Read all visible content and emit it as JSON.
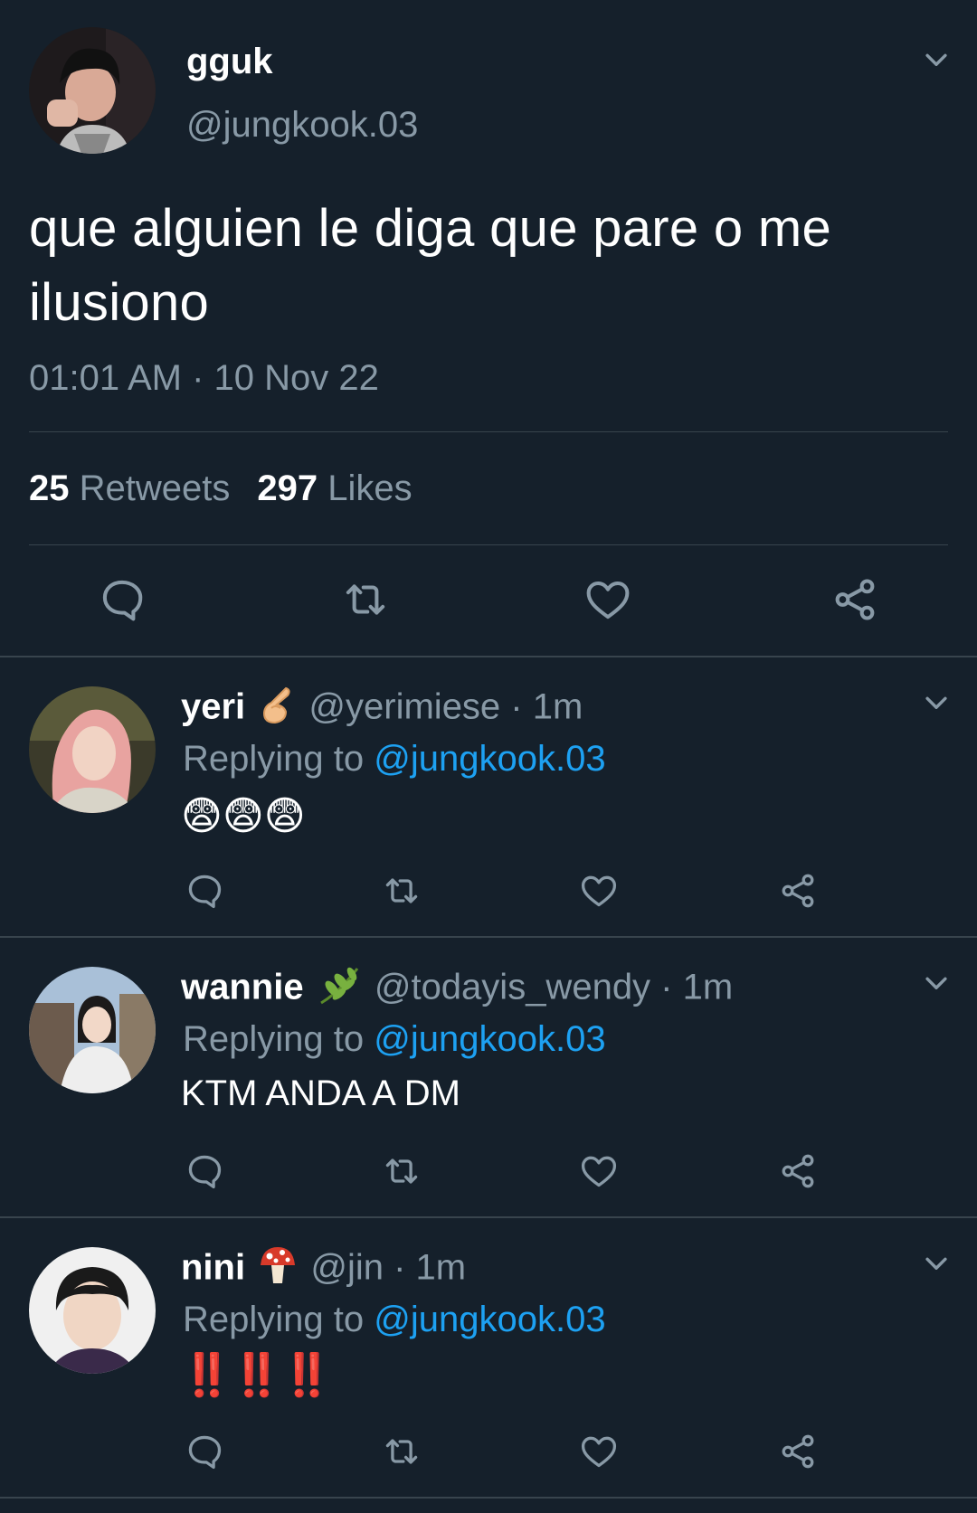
{
  "main_tweet": {
    "display_name": "gguk",
    "handle": "@jungkook.03",
    "text": "que alguien le diga que pare o me ilusiono",
    "timestamp": "01:01 AM · 10 Nov 22",
    "retweets_count": "25",
    "retweets_label": "Retweets",
    "likes_count": "297",
    "likes_label": "Likes"
  },
  "replies": [
    {
      "display_name": "yeri",
      "name_emoji": "pinching-hand",
      "handle_time": "@yerimiese · 1m",
      "replying_prefix": "Replying to",
      "replying_handle": "@jungkook.03",
      "body": "😨😨😨"
    },
    {
      "display_name": "wannie",
      "name_emoji": "herb",
      "handle_time": "@todayis_wendy · 1m",
      "replying_prefix": "Replying to",
      "replying_handle": "@jungkook.03",
      "body": "KTM ANDA A DM"
    },
    {
      "display_name": "nini",
      "name_emoji": "mushroom",
      "handle_time": "@jin · 1m",
      "replying_prefix": "Replying to",
      "replying_handle": "@jungkook.03",
      "body": "‼️‼️‼️"
    }
  ],
  "colors": {
    "background": "#15202b",
    "muted_text": "#8899a6",
    "link": "#1da1f2",
    "divider": "#38444d"
  },
  "icons": [
    "chevron-down-icon",
    "reply-icon",
    "retweet-icon",
    "like-icon",
    "share-icon"
  ]
}
